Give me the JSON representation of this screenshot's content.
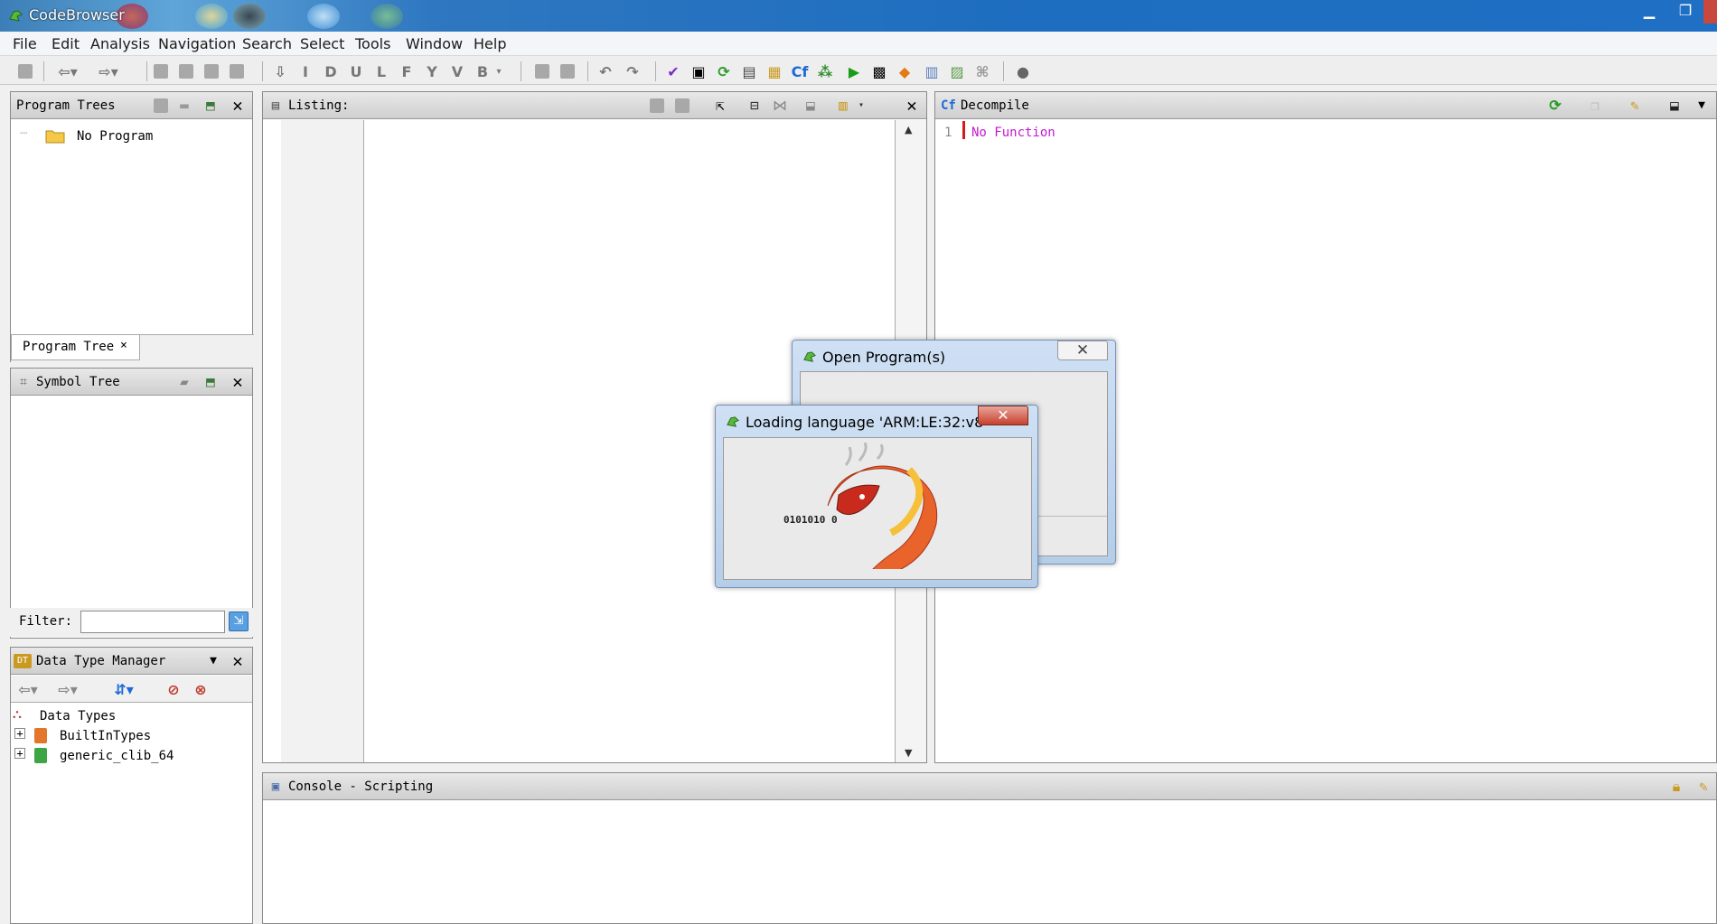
{
  "window": {
    "title": "CodeBrowser",
    "min_glyph": "▁",
    "max_glyph": "❐",
    "close_glyph": ""
  },
  "menu": [
    "File",
    "Edit",
    "Analysis",
    "Navigation",
    "Search",
    "Select",
    "Tools",
    "Window",
    "Help"
  ],
  "toolbar_letters": [
    "I",
    "D",
    "U",
    "L",
    "F",
    "Y",
    "V",
    "B"
  ],
  "program_trees": {
    "title": "Program Trees",
    "root": "No Program",
    "tab_label": "Program Tree",
    "tab_close": "×"
  },
  "symbol_tree": {
    "title": "Symbol Tree",
    "filter_label": "Filter:",
    "filter_value": ""
  },
  "data_type_manager": {
    "title": "Data Type Manager",
    "root": "Data Types",
    "items": [
      "BuiltInTypes",
      "generic_clib_64"
    ]
  },
  "listing": {
    "title": "Listing:"
  },
  "decompile": {
    "title": "Decompile",
    "line_number": "1",
    "text": "No Function"
  },
  "console": {
    "title": "Console - Scripting"
  },
  "open_dialog": {
    "title": "Open Program(s)",
    "close_glyph": "✕"
  },
  "loading_dialog": {
    "title": "Loading language 'ARM:LE:32:v8'",
    "close_glyph": "✕",
    "binary_text": "0101010  0"
  },
  "colors": {
    "titlebar": "#1d6dc0",
    "decompile_text": "#c419d2",
    "accent_red": "#d21b1b"
  }
}
